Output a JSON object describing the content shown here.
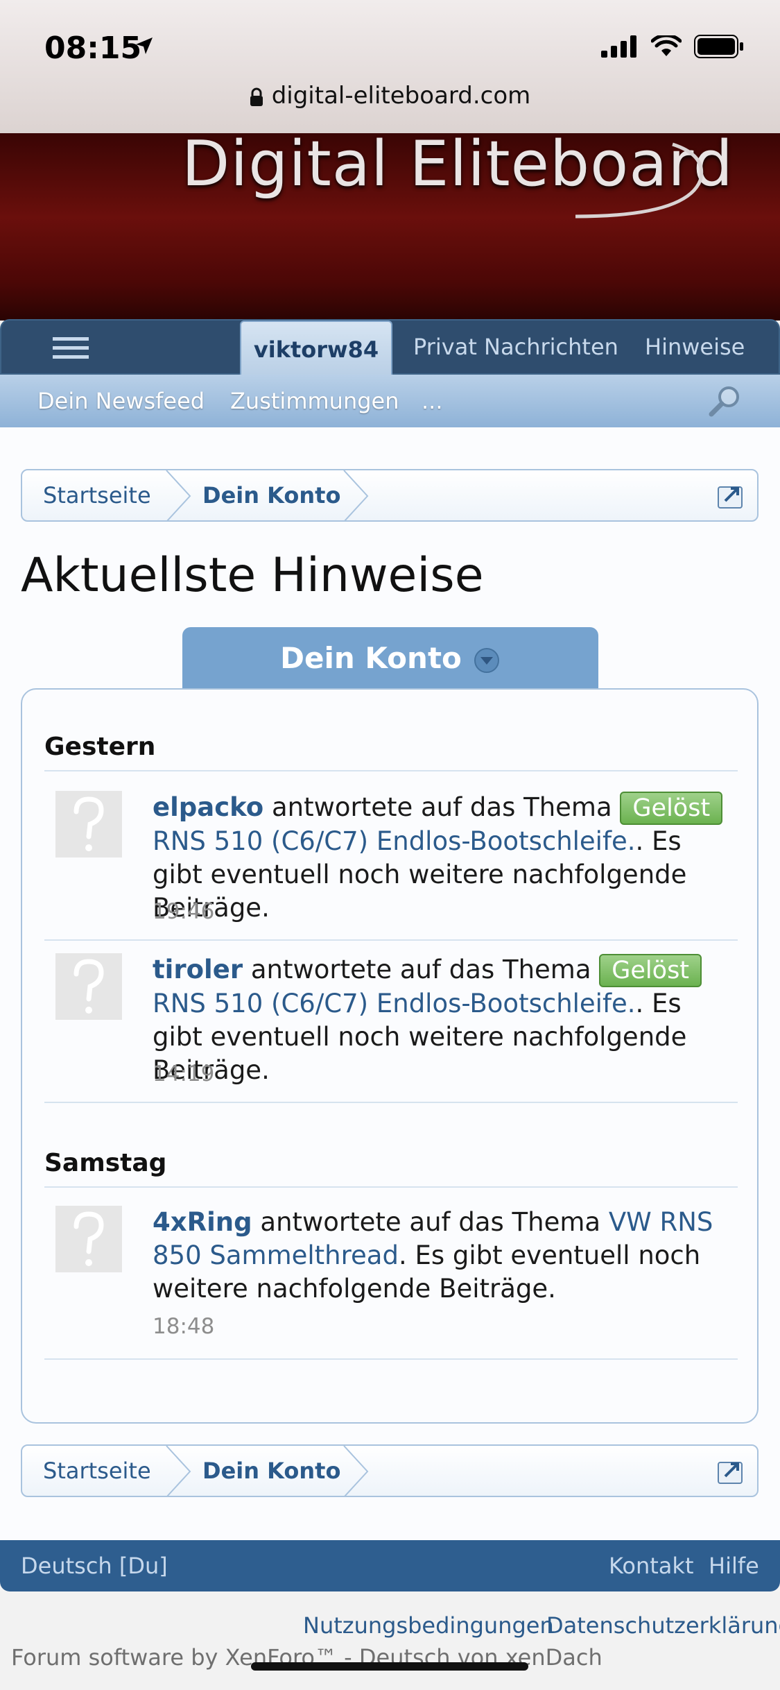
{
  "status_bar": {
    "time": "08:15"
  },
  "browser": {
    "url": "digital-eliteboard.com"
  },
  "site": {
    "logo_text": "Digital Eliteboard"
  },
  "nav": {
    "active_tab": "viktorw84",
    "tabs": [
      "Privat Nachrichten",
      "Hinweise"
    ],
    "sub_links": [
      "Dein Newsfeed",
      "Zustimmungen",
      "..."
    ]
  },
  "breadcrumb": {
    "items": [
      "Startseite",
      "Dein Konto"
    ]
  },
  "page": {
    "title": "Aktuellste Hinweise"
  },
  "section_tab": {
    "label": "Dein Konto"
  },
  "alerts": [
    {
      "day": "Gestern",
      "items": [
        {
          "user": "elpacko",
          "action": "antwortete auf das Thema",
          "badge": "Gelöst",
          "thread": "RNS 510 (C6/C7) Endlos-Bootschleife.",
          "suffix": ". Es gibt eventuell noch weitere nachfolgende Beiträge.",
          "time": "19:46"
        },
        {
          "user": "tiroler",
          "action": "antwortete auf das Thema",
          "badge": "Gelöst",
          "thread": "RNS 510 (C6/C7) Endlos-Bootschleife.",
          "suffix": ". Es gibt eventuell noch weitere nachfolgende Beiträge.",
          "time": "14:19"
        }
      ]
    },
    {
      "day": "Samstag",
      "items": [
        {
          "user": "4xRing",
          "action": "antwortete auf das Thema",
          "thread": "VW RNS 850 Sammelthread",
          "suffix": ". Es gibt eventuell noch weitere nachfolgende Beiträge.",
          "time": "18:48"
        }
      ]
    }
  ],
  "footer": {
    "language": "Deutsch [Du]",
    "links": [
      "Kontakt",
      "Hilfe"
    ],
    "legal_links": [
      "Nutzungsbedingungen",
      "Datenschutzerklärung"
    ],
    "credit": "Forum software by XenForo™ - Deutsch von xenDach"
  }
}
